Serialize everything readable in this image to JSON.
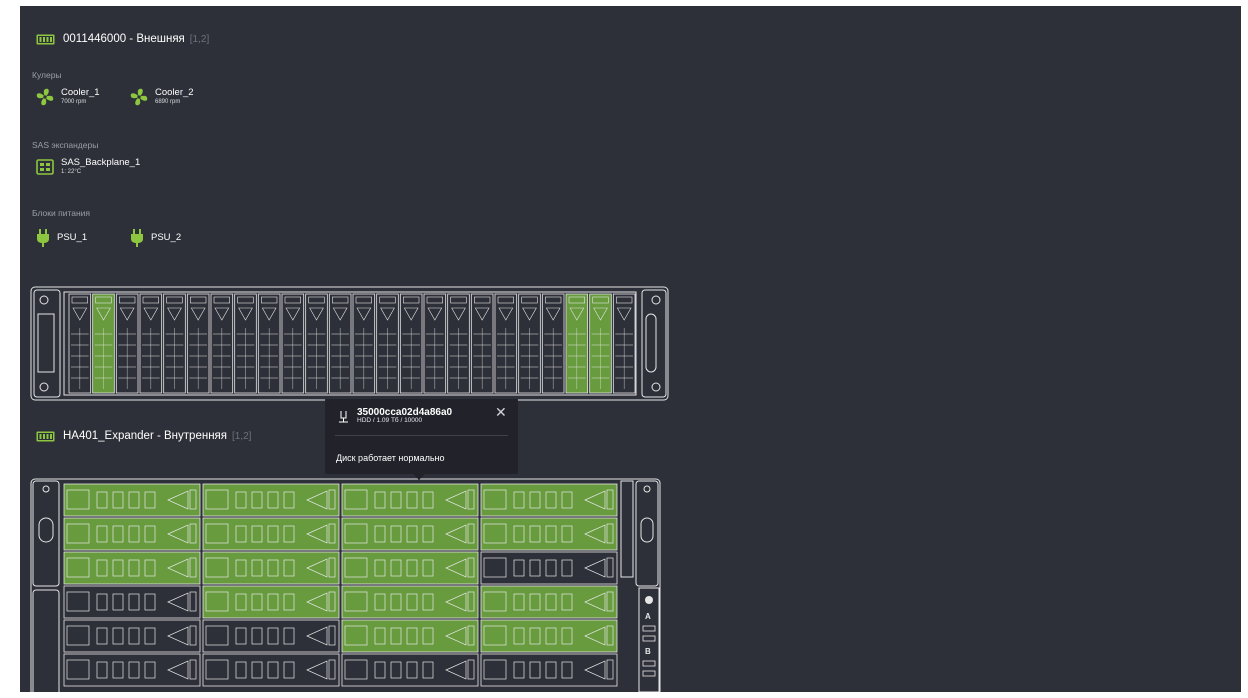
{
  "enclosure1": {
    "title": "0011446000 - Внешняя",
    "range": "[1,2]",
    "coolers_label": "Кулеры",
    "coolers": [
      {
        "name": "Cooler_1",
        "speed": "7000 rpm"
      },
      {
        "name": "Cooler_2",
        "speed": "6890 rpm"
      }
    ],
    "sas_label": "SAS экспандеры",
    "sas": [
      {
        "name": "SAS_Backplane_1",
        "temp": "1: 22°C"
      }
    ],
    "psu_label": "Блоки питания",
    "psus": [
      {
        "name": "PSU_1"
      },
      {
        "name": "PSU_2"
      }
    ],
    "bays": 24,
    "active_bays": [
      1,
      21,
      22
    ]
  },
  "enclosure2": {
    "title": "HA401_Expander - Внутренняя",
    "range": "[1,2]",
    "rows": 6,
    "cols": 4,
    "active": [
      [
        true,
        true,
        true,
        true
      ],
      [
        true,
        true,
        true,
        true
      ],
      [
        true,
        true,
        true,
        false
      ],
      [
        false,
        true,
        true,
        true
      ],
      [
        false,
        false,
        true,
        true
      ],
      [
        false,
        false,
        false,
        false
      ]
    ]
  },
  "tooltip": {
    "disk_id": "35000cca02d4a86a0",
    "spec": "HDD / 1.09 Тб / 10000",
    "status": "Диск работает нормально",
    "close_label": "✕"
  },
  "side_panel": {
    "labels": [
      "A",
      "B"
    ]
  },
  "colors": {
    "background": "#2e3039",
    "active": "#7bbf3f",
    "outline": "#e8e8e8",
    "tooltip": "#22232a"
  }
}
